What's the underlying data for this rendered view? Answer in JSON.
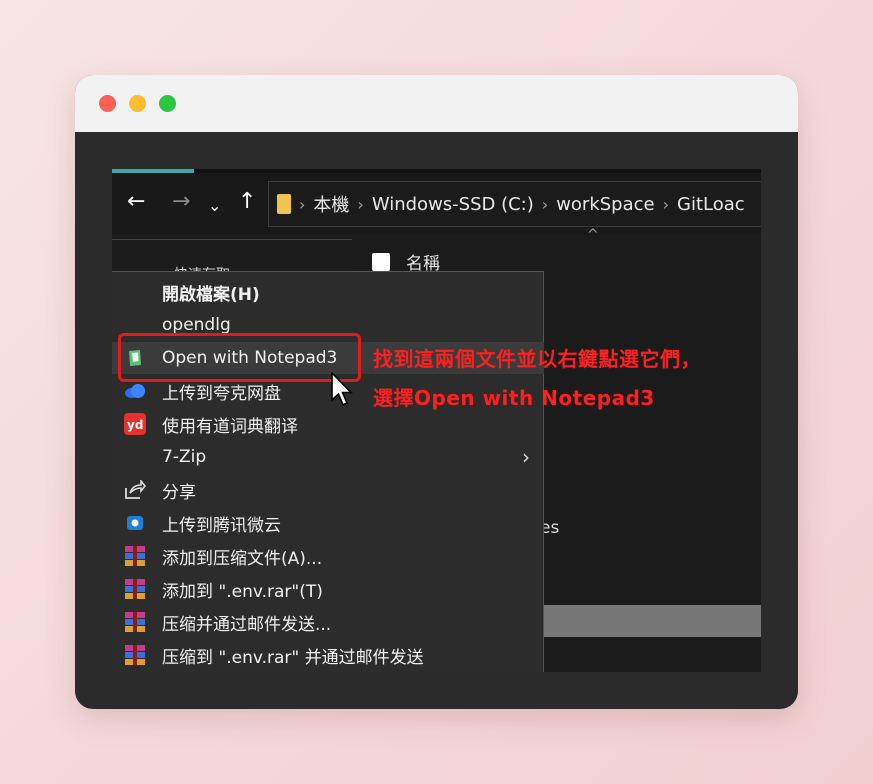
{
  "explorer": {
    "breadcrumb": [
      "本機",
      "Windows-SSD (C:)",
      "workSpace",
      "GitLoac"
    ],
    "column_header": "名稱",
    "partial_left_text": "快速存取",
    "partial_right_text": "es"
  },
  "context_menu": {
    "items": [
      {
        "label": "開啟檔案(H)",
        "icon": "none",
        "bold": true
      },
      {
        "label": "opendlg",
        "icon": "none"
      },
      {
        "label": "Open with Notepad3",
        "icon": "notepad3-icon"
      },
      {
        "label": "上传到夸克网盘",
        "icon": "quark-cloud-icon"
      },
      {
        "label": "使用有道词典翻译",
        "icon": "youdao-icon"
      },
      {
        "label": "7-Zip",
        "icon": "none",
        "submenu": true
      },
      {
        "label": "分享",
        "icon": "share-icon"
      },
      {
        "label": "上传到腾讯微云",
        "icon": "weiyun-icon"
      },
      {
        "label": "添加到压缩文件(A)...",
        "icon": "winrar-icon"
      },
      {
        "label": "添加到 \".env.rar\"(T)",
        "icon": "winrar-icon"
      },
      {
        "label": "压缩并通过邮件发送...",
        "icon": "winrar-icon"
      },
      {
        "label": "压缩到 \".env.rar\" 并通过邮件发送",
        "icon": "winrar-icon"
      }
    ]
  },
  "annotation": {
    "line1": "找到這兩個文件並以右鍵點選它們，",
    "line2": "選擇Open with Notepad3"
  },
  "colors": {
    "accent": "#3fa6a6",
    "annotation_red": "#ff1f1f",
    "highlight_red": "#e21b1b"
  }
}
